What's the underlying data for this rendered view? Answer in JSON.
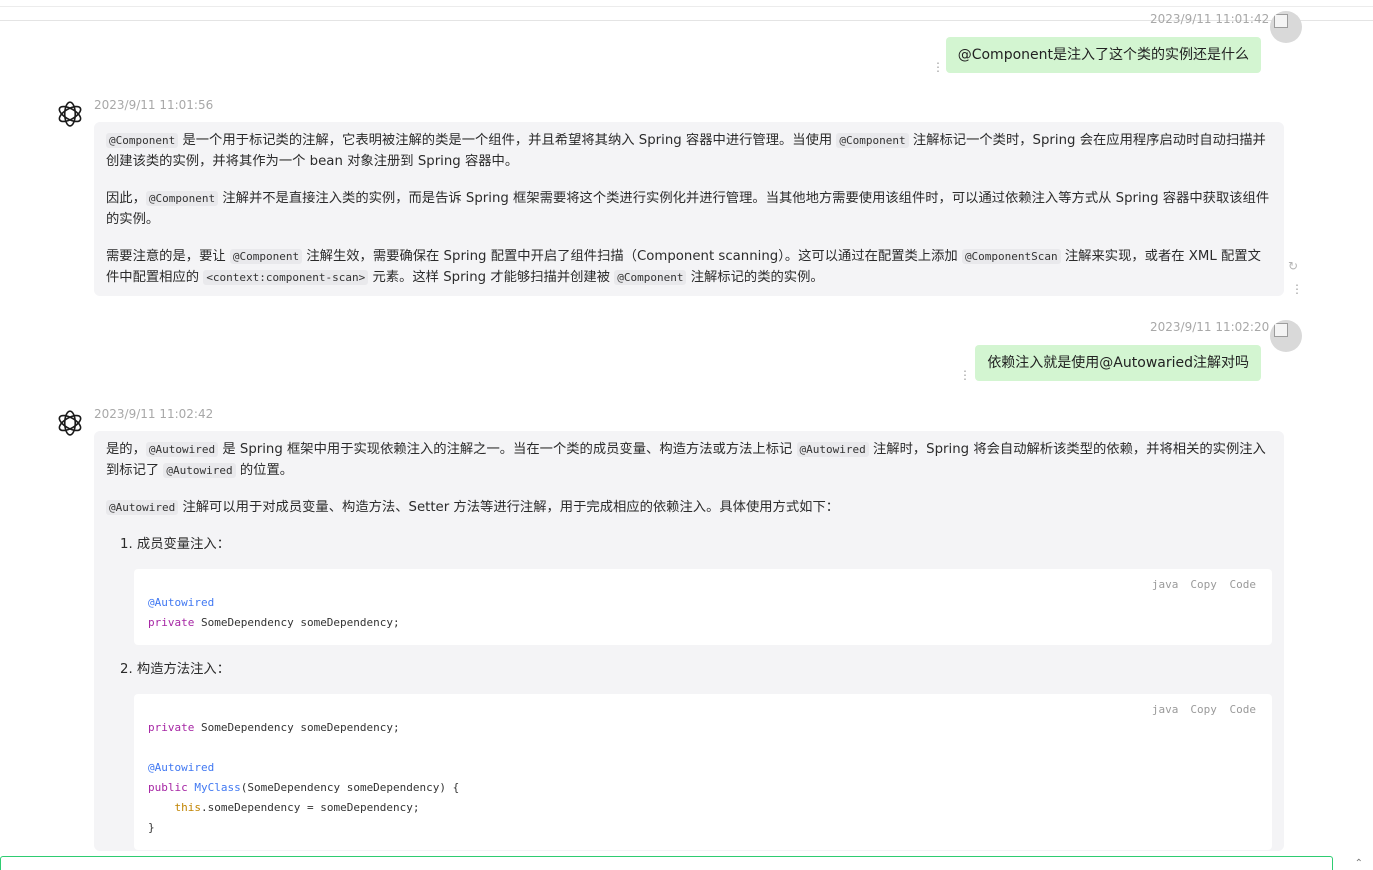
{
  "messages": {
    "m1": {
      "role": "user",
      "time": "2023/9/11 11:01:42",
      "text": "@Component是注入了这个类的实例还是什么"
    },
    "m2": {
      "role": "assistant",
      "time": "2023/9/11 11:01:56",
      "p1_a": "是一个用于标记类的注解，它表明被注解的类是一个组件，并且希望将其纳入 Spring 容器中进行管理。当使用 ",
      "p1_b": " 注解标记一个类时，Spring 会在应用程序启动时自动扫描并创建该类的实例，并将其作为一个 bean 对象注册到 Spring 容器中。",
      "p2_a": "因此，",
      "p2_b": " 注解并不是直接注入类的实例，而是告诉 Spring 框架需要将这个类进行实例化并进行管理。当其他地方需要使用该组件时，可以通过依赖注入等方式从 Spring 容器中获取该组件的实例。",
      "p3_a": "需要注意的是，要让 ",
      "p3_b": " 注解生效，需要确保在 Spring 配置中开启了组件扫描（Component scanning）。这可以通过在配置类上添加 ",
      "p3_c": " 注解来实现，或者在 XML 配置文件中配置相应的 ",
      "p3_d": " 元素。这样 Spring 才能够扫描并创建被 ",
      "p3_e": " 注解标记的类的实例。",
      "code_component": "@Component",
      "code_componentscan": "@ComponentScan",
      "code_context": "<context:component-scan>"
    },
    "m3": {
      "role": "user",
      "time": "2023/9/11 11:02:20",
      "text": "依赖注入就是使用@Autowaried注解对吗"
    },
    "m4": {
      "role": "assistant",
      "time": "2023/9/11 11:02:42",
      "p1_a": "是的，",
      "p1_b": " 是 Spring 框架中用于实现依赖注入的注解之一。当在一个类的成员变量、构造方法或方法上标记 ",
      "p1_c": " 注解时，Spring 将会自动解析该类型的依赖，并将相关的实例注入到标记了 ",
      "p1_d": " 的位置。",
      "p2_b": " 注解可以用于对成员变量、构造方法、Setter 方法等进行注解，用于完成相应的依赖注入。具体使用方式如下：",
      "code_autowired": "@Autowired",
      "item1": "1. 成员变量注入：",
      "item2": "2. 构造方法注入：",
      "code1_line1": "@Autowired",
      "code1_line2_kw": "private",
      "code1_line2_rest": " SomeDependency someDependency;",
      "code2_line1_kw": "private",
      "code2_line1_rest": " SomeDependency someDependency;",
      "code2_line3": "@Autowired",
      "code2_line4_kw": "public",
      "code2_line4_fn": "MyClass",
      "code2_line4_rest": "(SomeDependency someDependency) {",
      "code2_line5_this": "this",
      "code2_line5_rest": ".someDependency = someDependency;",
      "code2_line6": "}"
    }
  },
  "code_header": {
    "lang": "java",
    "copy": "Copy",
    "code": "Code"
  },
  "icons": {
    "more": "⋮",
    "refresh": "↻",
    "corner": "⌃"
  }
}
